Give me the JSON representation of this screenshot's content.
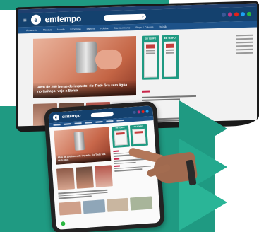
{
  "monitor": {
    "brand": "emtempo",
    "logo_letter": "e",
    "menu_glyph": "≡",
    "search_icon": "⌕",
    "nav_items": [
      "Amazonas",
      "Manaus",
      "Mundo",
      "Economia",
      "Esporte",
      "Política",
      "Entretenimento",
      "Blogs & Colunas",
      "Opinião"
    ],
    "hero_caption": "Alvo de 200 horas de impacto, rio Tietê fica sem água no tarifaço, veja a Bolsa",
    "ad_label": "EM TEMPO"
  },
  "tablet": {
    "brand": "emtempo",
    "logo_letter": "e",
    "hero_caption": "Alvo de 200 horas de impacto, rio Tietê fica sem água",
    "ad_label": "EM TEMPO"
  },
  "colors": {
    "teal": "#1f9a82",
    "navy": "#14416e",
    "accent_red": "#c8264a",
    "whatsapp": "#2bb741"
  },
  "icons": [
    "menu-icon",
    "search-icon",
    "facebook-icon",
    "instagram-icon",
    "youtube-icon",
    "twitter-icon",
    "whatsapp-icon",
    "play-chevron-icon"
  ]
}
